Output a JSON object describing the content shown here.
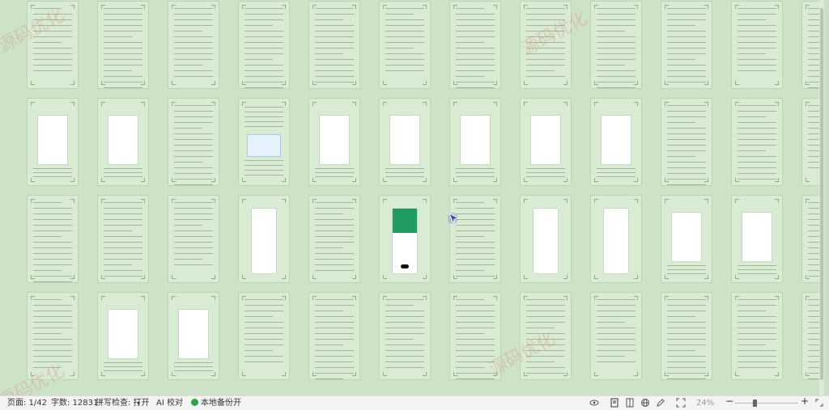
{
  "document": {
    "page_count": 42,
    "visible_rows": 4,
    "pages_per_row": 12
  },
  "watermark_text": "源码优化",
  "status": {
    "page_label": "页面: 1/42",
    "wordcount_label": "字数: 12831",
    "spellcheck_label": "拼写检查: 打开",
    "ai_label": "AI 校对",
    "backup_label": "本地备份开",
    "zoom_label": "24%",
    "zoom_minus": "−",
    "zoom_plus": "+",
    "zoom_level_percent": 24
  },
  "icons": {
    "eye": "eye-icon",
    "page_view": "page-view-icon",
    "outline_view": "outline-view-icon",
    "web_view": "web-view-icon",
    "pen": "pen-icon",
    "fullscreen": "fullscreen-icon",
    "cursor": "cursor-arrow-icon"
  },
  "colors": {
    "canvas": "#cde3c7",
    "page": "#d9ebd3",
    "green_accent": "#28a745",
    "status_bg": "#f4f4f4"
  }
}
